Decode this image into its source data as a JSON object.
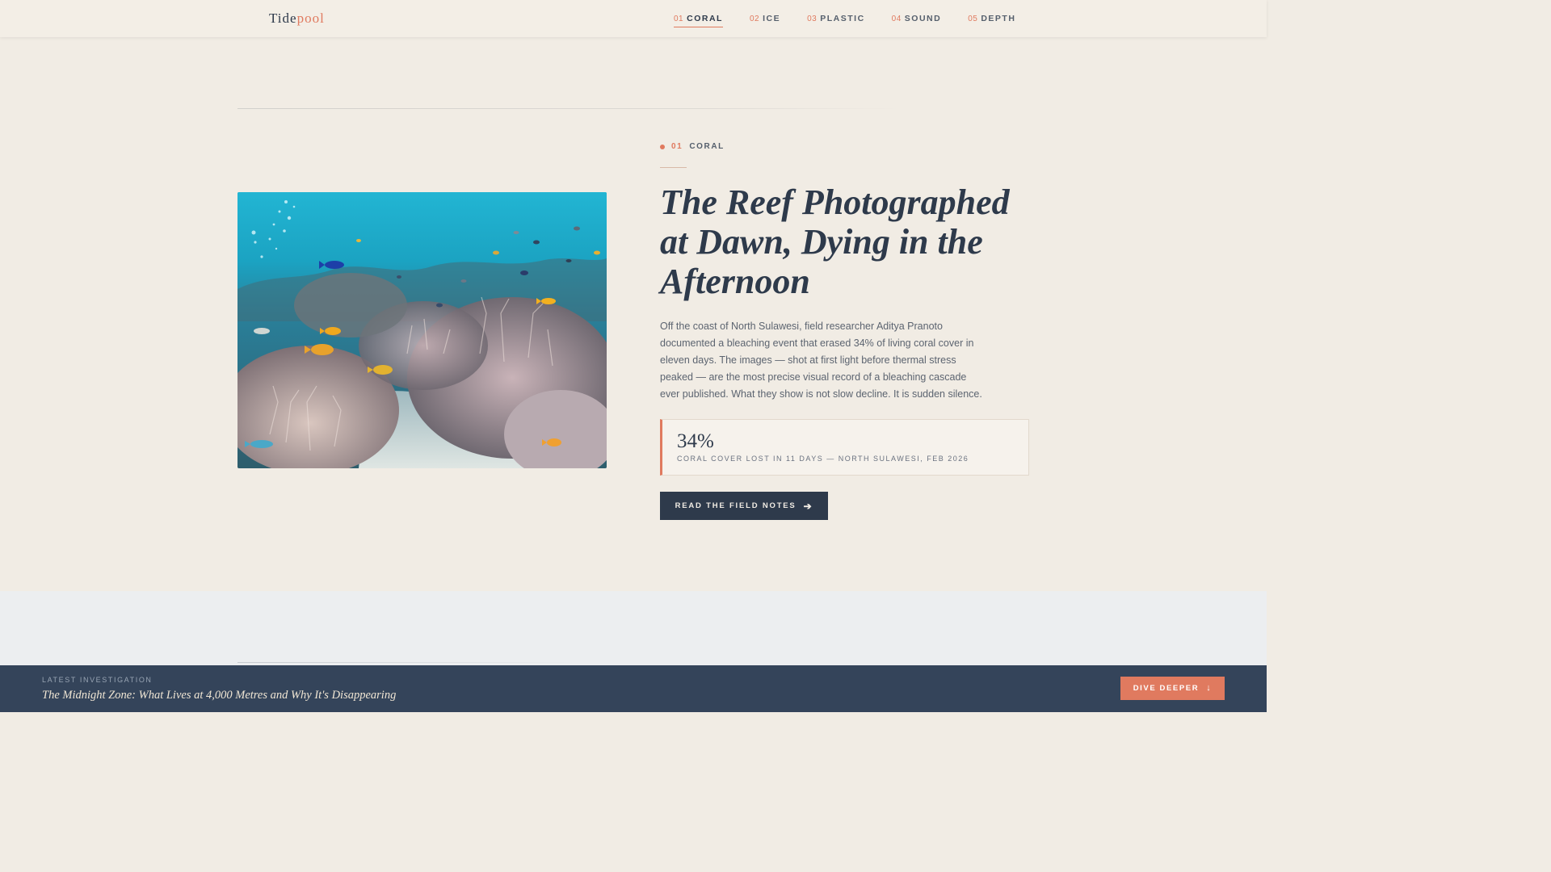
{
  "brand": {
    "part1": "Tide",
    "part2": "pool"
  },
  "nav": {
    "items": [
      {
        "num": "01",
        "label": "CORAL"
      },
      {
        "num": "02",
        "label": "ICE"
      },
      {
        "num": "03",
        "label": "PLASTIC"
      },
      {
        "num": "04",
        "label": "SOUND"
      },
      {
        "num": "05",
        "label": "DEPTH"
      }
    ],
    "active": "CORAL"
  },
  "article": {
    "kicker_num": "01",
    "kicker_label": "CORAL",
    "headline": "The Reef Photographed at Dawn, Dying in the Afternoon",
    "dek": "Off the coast of North Sulawesi, field researcher Aditya Pranoto documented a bleaching event that erased 34% of living coral cover in eleven days. The images — shot at first light before thermal stress peaked — are the most precise visual record of a bleaching cascade ever published. What they show is not slow decline. It is sudden silence.",
    "stat_value": "34%",
    "stat_label": "CORAL COVER LOST IN 11 DAYS — NORTH SULAWESI, FEB 2026",
    "cta_label": "READ THE FIELD NOTES",
    "cta_icon": "arrow-right-icon"
  },
  "footer_bar": {
    "label": "LATEST INVESTIGATION",
    "title": "The Midnight Zone: What Lives at 4,000 Metres and Why It's Disappearing",
    "button_label": "DIVE DEEPER",
    "button_icon": "arrow-down-icon"
  },
  "colors": {
    "background": "#f1ece4",
    "ink": "#2e3a4b",
    "accent": "#e07a5f",
    "footer": "#34445a"
  }
}
